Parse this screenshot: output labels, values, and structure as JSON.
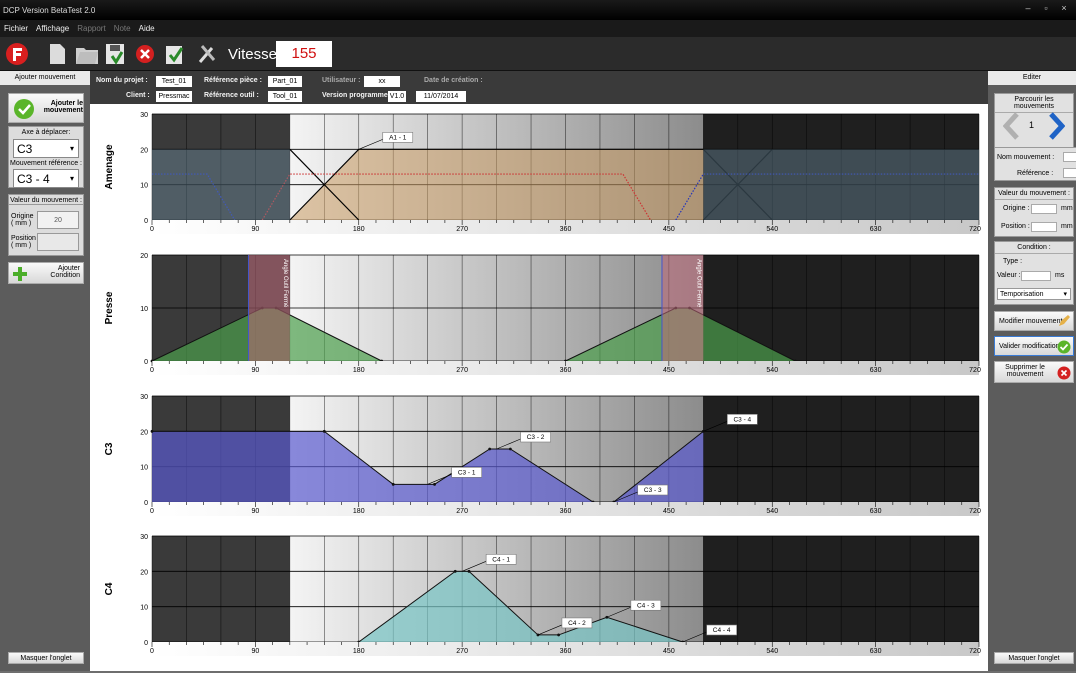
{
  "window": {
    "title": "DCP Version BetaTest 2.0"
  },
  "menu": [
    "Fichier",
    "Affichage",
    "Rapport",
    "Note",
    "Aide"
  ],
  "toolbar": {
    "speed_label": "Vitesse :",
    "speed_value": "155"
  },
  "left": {
    "header": "Ajouter mouvement",
    "add_move": "Ajouter le mouvement",
    "axis_label": "Axe à déplacer:",
    "axis_value": "C3",
    "ref_label": "Mouvement référence :",
    "ref_value": "C3 - 4",
    "value_label": "Valeur du mouvement :",
    "origin_label": "Origine ( mm )",
    "origin_value": "20",
    "position_label": "Position ( mm )",
    "add_condition": "Ajouter Condition",
    "hide_tab": "Masquer l'onglet"
  },
  "info": {
    "project_label": "Nom du projet :",
    "project": "Test_01",
    "client_label": "Client :",
    "client": "Pressmac",
    "ref_piece_label": "Référence pièce :",
    "ref_piece": "Part_01",
    "ref_tool_label": "Référence outil :",
    "ref_tool": "Tool_01",
    "user_label": "Utilisateur :",
    "user": "xx",
    "version_label": "Version programme :",
    "version": "V1.0",
    "date_label": "Date de création :",
    "date": "11/07/2014"
  },
  "right": {
    "header": "Editer",
    "browse": "Parcourir les mouvements",
    "index": "1",
    "name_label": "Nom mouvement :",
    "ref_label": "Référence :",
    "value_label": "Valeur du mouvement :",
    "origin_label": "Origine :",
    "position_label": "Position :",
    "unit_mm": "mm",
    "unit_ms": "ms",
    "cond_label": "Condition :",
    "type_label": "Type :",
    "valeur_label": "Valeur :",
    "cond_select": "Temporisation",
    "modify": "Modifier mouvement",
    "validate": "Valider modification",
    "delete": "Supprimer le mouvement",
    "hide_tab": "Masquer l'onglet"
  },
  "chart_data": [
    {
      "type": "area",
      "title": "Amenage",
      "xlim": [
        0,
        720
      ],
      "ylim": [
        0,
        30
      ],
      "xticks": [
        0,
        90,
        180,
        270,
        360,
        450,
        540,
        630,
        720
      ],
      "yticks": [
        0,
        10,
        20,
        30
      ],
      "series": [
        {
          "x": [
            120,
            180,
            480
          ],
          "y": [
            0,
            20,
            20
          ],
          "color": "#000000"
        },
        {
          "x": [
            120,
            180
          ],
          "y": [
            20,
            0
          ],
          "color": "#000000"
        },
        {
          "x": [
            480,
            540
          ],
          "y": [
            0,
            20
          ],
          "color": "#000000"
        },
        {
          "x": [
            480,
            540
          ],
          "y": [
            20,
            0
          ],
          "color": "#000000"
        },
        {
          "x": [
            0,
            48,
            72
          ],
          "y": [
            13,
            13,
            0
          ],
          "color": "#2233bb",
          "style": "dotted"
        },
        {
          "x": [
            96,
            120,
            410,
            434
          ],
          "y": [
            0,
            13,
            13,
            0
          ],
          "color": "#cc3333",
          "style": "dotted"
        },
        {
          "x": [
            456,
            480,
            720
          ],
          "y": [
            0,
            13,
            13
          ],
          "color": "#2233bb",
          "style": "dotted"
        }
      ],
      "annotations": [
        {
          "label": "A1 - 1",
          "x": 180,
          "y": 20
        }
      ]
    },
    {
      "type": "area",
      "title": "Presse",
      "xlim": [
        0,
        720
      ],
      "ylim": [
        0,
        20
      ],
      "xticks": [
        0,
        90,
        180,
        270,
        360,
        450,
        540,
        630,
        720
      ],
      "yticks": [
        0,
        10,
        20
      ],
      "series": [
        {
          "x": [
            0,
            96,
            108,
            200
          ],
          "y": [
            0,
            10,
            10,
            0
          ],
          "color": "#2d6e2d"
        },
        {
          "x": [
            360,
            456,
            468,
            560
          ],
          "y": [
            0,
            10,
            10,
            0
          ],
          "color": "#2d6e2d"
        }
      ],
      "annotations": [
        {
          "label": "Angle Outil Fermé",
          "x": 120
        },
        {
          "label": "Angle Outil Fermé",
          "x": 480
        }
      ]
    },
    {
      "type": "area",
      "title": "C3",
      "xlim": [
        0,
        720
      ],
      "ylim": [
        0,
        30
      ],
      "xticks": [
        0,
        90,
        180,
        270,
        360,
        450,
        540,
        630,
        720
      ],
      "yticks": [
        0,
        10,
        20,
        30
      ],
      "series": [
        {
          "x": [
            0,
            150,
            210,
            246,
            294,
            312,
            384,
            402,
            480
          ],
          "y": [
            20,
            20,
            5,
            5,
            15,
            15,
            0,
            0,
            20
          ],
          "color": "#2d2d8a"
        }
      ],
      "annotations": [
        {
          "label": "C3 - 1",
          "x": 240,
          "y": 5
        },
        {
          "label": "C3 - 2",
          "x": 300,
          "y": 15
        },
        {
          "label": "C3 - 3",
          "x": 402,
          "y": 0
        },
        {
          "label": "C3 - 4",
          "x": 480,
          "y": 20
        }
      ]
    },
    {
      "type": "area",
      "title": "C4",
      "xlim": [
        0,
        720
      ],
      "ylim": [
        0,
        30
      ],
      "xticks": [
        0,
        90,
        180,
        270,
        360,
        450,
        540,
        630,
        720
      ],
      "yticks": [
        0,
        10,
        20,
        30
      ],
      "series": [
        {
          "x": [
            180,
            264,
            276,
            336,
            354,
            396,
            462
          ],
          "y": [
            0,
            20,
            20,
            2,
            2,
            7,
            0
          ],
          "color": "#2a7d7d"
        }
      ],
      "annotations": [
        {
          "label": "C4 - 1",
          "x": 270,
          "y": 20
        },
        {
          "label": "C4 - 2",
          "x": 336,
          "y": 2
        },
        {
          "label": "C4 - 3",
          "x": 396,
          "y": 7
        },
        {
          "label": "C4 - 4",
          "x": 462,
          "y": 0
        }
      ]
    }
  ],
  "colors": {
    "window_bg": "#6e6e6e",
    "speed_text": "#d01010"
  }
}
